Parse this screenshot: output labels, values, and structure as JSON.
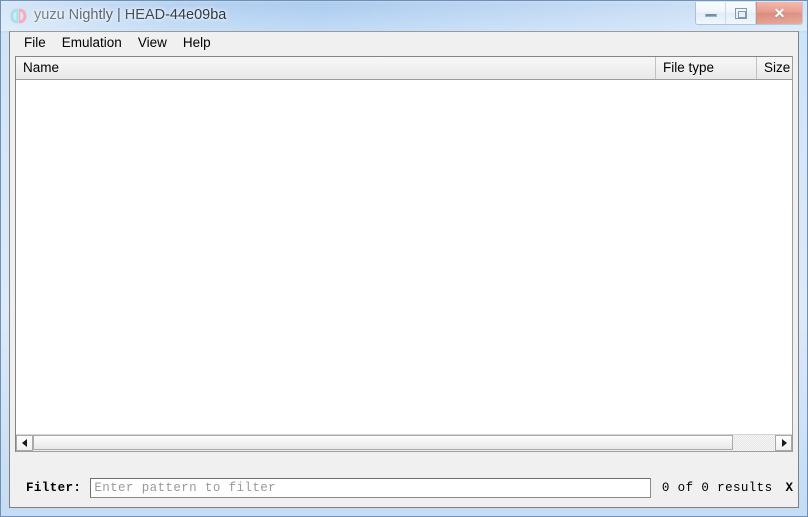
{
  "window": {
    "title": "yuzu Nightly | HEAD-44e09ba",
    "icon": "yuzu-logo-icon",
    "controls": {
      "minimize_label": "minimize-icon",
      "restore_label": "restore-icon",
      "close_label": "✕"
    }
  },
  "menu": {
    "items": [
      {
        "label": "File"
      },
      {
        "label": "Emulation"
      },
      {
        "label": "View"
      },
      {
        "label": "Help"
      }
    ]
  },
  "game_list": {
    "columns": [
      {
        "label": "Name"
      },
      {
        "label": "File type"
      },
      {
        "label": "Size"
      }
    ],
    "rows": []
  },
  "scrollbar": {
    "left_arrow": "chevron-left-icon",
    "right_arrow": "chevron-right-icon"
  },
  "filter": {
    "label": "Filter:",
    "placeholder": "Enter pattern to filter",
    "value": "",
    "results_text": "0 of 0 results",
    "clear_label": "X"
  },
  "colors": {
    "frame": "#aecdf4",
    "close_button": "#d4452a",
    "logo_left": "#4cc3d9",
    "logo_right": "#f2607a",
    "client": "#f0f0f0"
  }
}
